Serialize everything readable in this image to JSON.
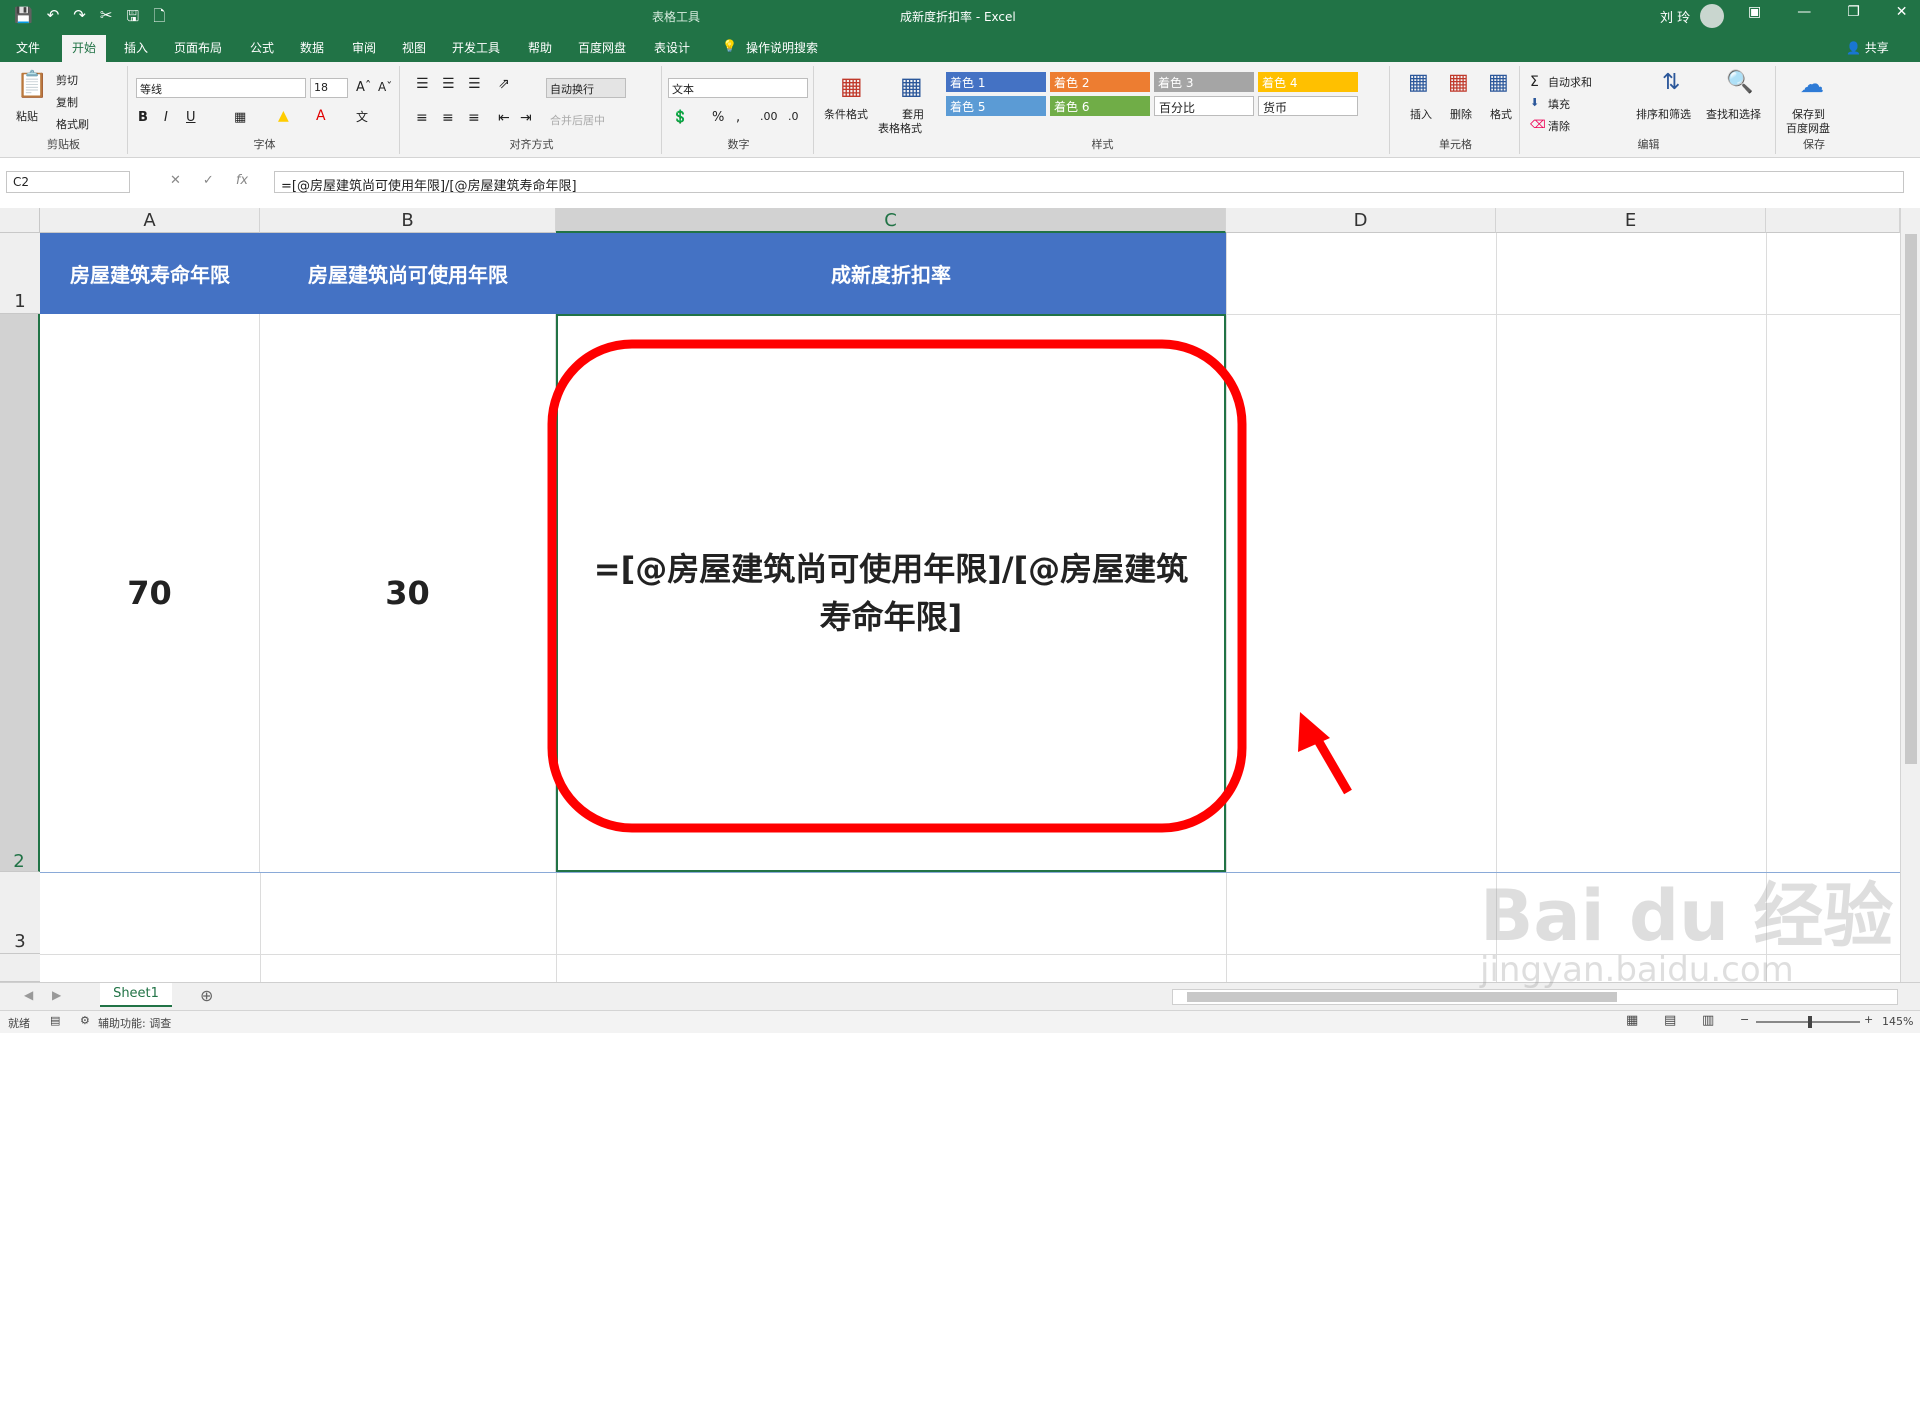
{
  "titlebar": {
    "context": "表格工具",
    "title": "成新度折扣率 - Excel",
    "user": "刘 玲",
    "qat_icons": [
      "save-icon",
      "undo-icon",
      "redo-icon",
      "cut-icon",
      "saveas-icon",
      "new-icon"
    ]
  },
  "tabs": [
    {
      "label": "文件"
    },
    {
      "label": "开始"
    },
    {
      "label": "插入"
    },
    {
      "label": "页面布局"
    },
    {
      "label": "公式"
    },
    {
      "label": "数据"
    },
    {
      "label": "审阅"
    },
    {
      "label": "视图"
    },
    {
      "label": "开发工具"
    },
    {
      "label": "帮助"
    },
    {
      "label": "百度网盘"
    },
    {
      "label": "表设计"
    }
  ],
  "tell_me": "操作说明搜索",
  "share": "共享",
  "ribbon": {
    "clipboard": {
      "paste": "粘贴",
      "cut": "剪切",
      "copy": "复制",
      "format_painter": "格式刷",
      "label": "剪贴板"
    },
    "font": {
      "name": "等线",
      "size": "18",
      "label": "字体"
    },
    "alignment": {
      "wrap": "自动换行",
      "merge": "合并后居中",
      "label": "对齐方式"
    },
    "number": {
      "format": "文本",
      "label": "数字"
    },
    "styles": {
      "conditional": "条件格式",
      "table_format_1": "套用",
      "table_format_2": "表格格式",
      "label": "样式",
      "cells": [
        {
          "text": "着色 1",
          "color": "#4472c4"
        },
        {
          "text": "着色 2",
          "color": "#ed7d31"
        },
        {
          "text": "着色 3",
          "color": "#a5a5a5"
        },
        {
          "text": "着色 4",
          "color": "#ffc000"
        },
        {
          "text": "着色 5",
          "color": "#5b9bd5"
        },
        {
          "text": "着色 6",
          "color": "#70ad47"
        },
        {
          "text": "百分比",
          "color": "#ffffff"
        },
        {
          "text": "货币",
          "color": "#ffffff"
        }
      ]
    },
    "cells": {
      "insert": "插入",
      "delete": "删除",
      "format": "格式",
      "label": "单元格"
    },
    "editing": {
      "autosum": "自动求和",
      "fill": "填充",
      "clear": "清除",
      "sort": "排序和筛选",
      "find": "查找和选择",
      "label": "编辑"
    },
    "save": {
      "line1": "保存到",
      "line2": "百度网盘",
      "label": "保存"
    }
  },
  "formula_bar": {
    "name_box": "C2",
    "formula": "=[@房屋建筑尚可使用年限]/[@房屋建筑寿命年限]"
  },
  "grid": {
    "columns": [
      "A",
      "B",
      "C",
      "D",
      "E"
    ],
    "rows": [
      "1",
      "2",
      "3"
    ],
    "header_row": [
      "房屋建筑寿命年限",
      "房屋建筑尚可使用年限",
      "成新度折扣率"
    ],
    "data_row": [
      "70",
      "30",
      "=[@房屋建筑尚可使用年限]/[@房屋建筑寿命年限]"
    ],
    "header_fill": "#4472c4"
  },
  "sheets": [
    {
      "name": "Sheet1"
    }
  ],
  "status": {
    "ready": "就绪",
    "accessibility": "辅助功能: 调查",
    "zoom": "145%"
  },
  "annotation_color": "#ff0000",
  "watermark": {
    "brand": "Bai du 经验",
    "url": "jingyan.baidu.com"
  }
}
